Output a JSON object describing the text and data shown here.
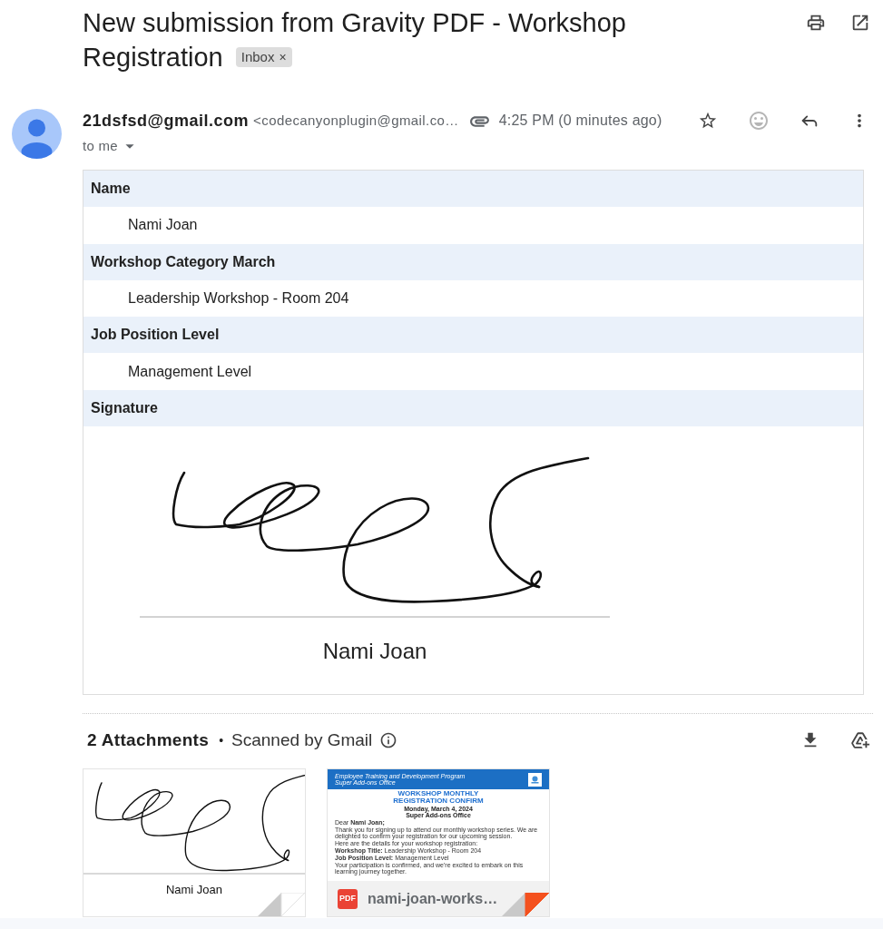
{
  "subject": {
    "title_lines": [
      "New submission from Gravity PDF - Workshop",
      "Registration"
    ],
    "label": "Inbox",
    "label_remove": "×"
  },
  "message": {
    "sender_name": "21dsfsd@gmail.com",
    "sender_email": "<codecanyonplugin@gmail.co…",
    "time": "4:25 PM (0 minutes ago)",
    "starred": false,
    "recipients": "to me"
  },
  "fields": [
    {
      "kind": "text",
      "label": "Name",
      "value": "Nami Joan"
    },
    {
      "kind": "text",
      "label": "Workshop Category March",
      "value": "Leadership Workshop - Room 204"
    },
    {
      "kind": "text",
      "label": "Job Position Level",
      "value": "Management Level"
    },
    {
      "kind": "signature",
      "label": "Signature",
      "signer": "Nami Joan"
    }
  ],
  "attachments": {
    "count": "2 Attachments",
    "separator": "•",
    "scan_note": "Scanned by Gmail",
    "items": [
      {
        "kind": "image",
        "caption": "Nami Joan"
      },
      {
        "kind": "pdf",
        "type_label": "PDF",
        "file_name": "nami-joan-works…",
        "preview": {
          "program": "Employee Training and Development Program",
          "office": "Super Add-ons Office",
          "title_lines": [
            "WORKSHOP MONTHLY",
            "REGISTRATION CONFIRM"
          ],
          "date": "Monday, March 4, 2024",
          "venue": "Super Add-ons Office",
          "greeting": "Dear **Nami Joan;**",
          "paragraphs": [
            "Thank you for signing up to attend our monthly workshop series. We are delighted to confirm your registration for our upcoming session.",
            "Here are the details for your workshop registration:",
            "**Workshop Title:** Leadership Workshop - Room 204",
            "**Job Position Level:** Management Level",
            "Your participation is confirmed, and we're excited to embark on this learning journey together."
          ]
        }
      }
    ]
  }
}
